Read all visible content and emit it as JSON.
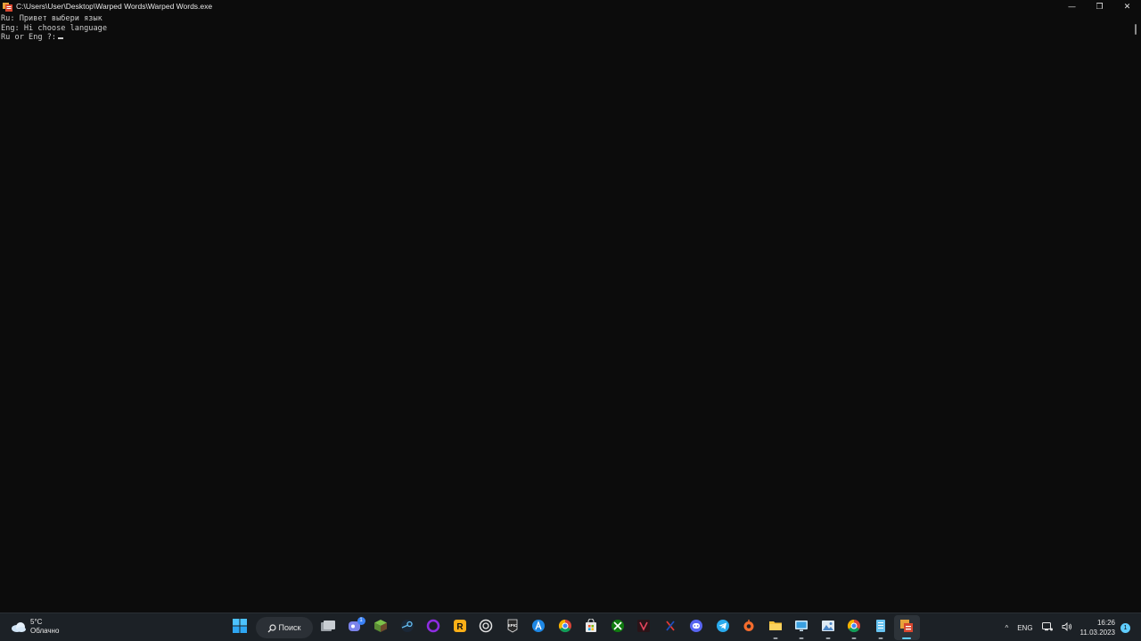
{
  "window": {
    "title": "C:\\Users\\User\\Desktop\\Warped Words\\Warped Words.exe",
    "controls": {
      "minimize": "—",
      "maximize": "❐",
      "close": "✕"
    }
  },
  "console": {
    "lines": [
      "Ru: Привет выбери язык",
      "Eng: Hi choose language",
      "Ru or Eng ?:"
    ]
  },
  "taskbar": {
    "weather": {
      "temp": "5°C",
      "condition": "Облачно",
      "icon": "cloud-icon"
    },
    "search_label": "Поиск",
    "apps": [
      {
        "name": "start",
        "icon": "windows-icon"
      },
      {
        "name": "search",
        "icon": "search-icon"
      },
      {
        "name": "task-view",
        "icon": "task-view-icon"
      },
      {
        "name": "chat",
        "icon": "chat-icon",
        "badge": "1"
      },
      {
        "name": "minecraft",
        "icon": "cube-icon"
      },
      {
        "name": "steam",
        "icon": "steam-icon"
      },
      {
        "name": "launcher",
        "icon": "ring-icon"
      },
      {
        "name": "rockstar",
        "icon": "rockstar-icon"
      },
      {
        "name": "ubisoft",
        "icon": "ubisoft-icon"
      },
      {
        "name": "epic",
        "icon": "epic-icon"
      },
      {
        "name": "app-store",
        "icon": "app-store-icon"
      },
      {
        "name": "chrome",
        "icon": "chrome-icon"
      },
      {
        "name": "ms-store",
        "icon": "store-icon"
      },
      {
        "name": "xbox",
        "icon": "xbox-icon"
      },
      {
        "name": "vivaldi",
        "icon": "v-icon"
      },
      {
        "name": "x-app",
        "icon": "x-icon"
      },
      {
        "name": "discord",
        "icon": "discord-icon"
      },
      {
        "name": "telegram",
        "icon": "telegram-icon"
      },
      {
        "name": "origin",
        "icon": "origin-icon"
      },
      {
        "name": "explorer",
        "icon": "folder-icon"
      },
      {
        "name": "remote",
        "icon": "monitor-icon"
      },
      {
        "name": "photos",
        "icon": "photos-icon"
      },
      {
        "name": "chrome-2",
        "icon": "chrome-icon"
      },
      {
        "name": "notepad",
        "icon": "notepad-icon"
      },
      {
        "name": "warped-words",
        "icon": "app-icon"
      }
    ],
    "tray": {
      "chevron": "^",
      "language": "ENG"
    },
    "clock": {
      "time": "16:26",
      "date": "11.03.2023"
    },
    "notifications": "1"
  },
  "colors": {
    "console_bg": "#0c0c0c",
    "console_text": "#cccccc",
    "taskbar_bg": "#1c2126",
    "accent": "#60cdff"
  }
}
